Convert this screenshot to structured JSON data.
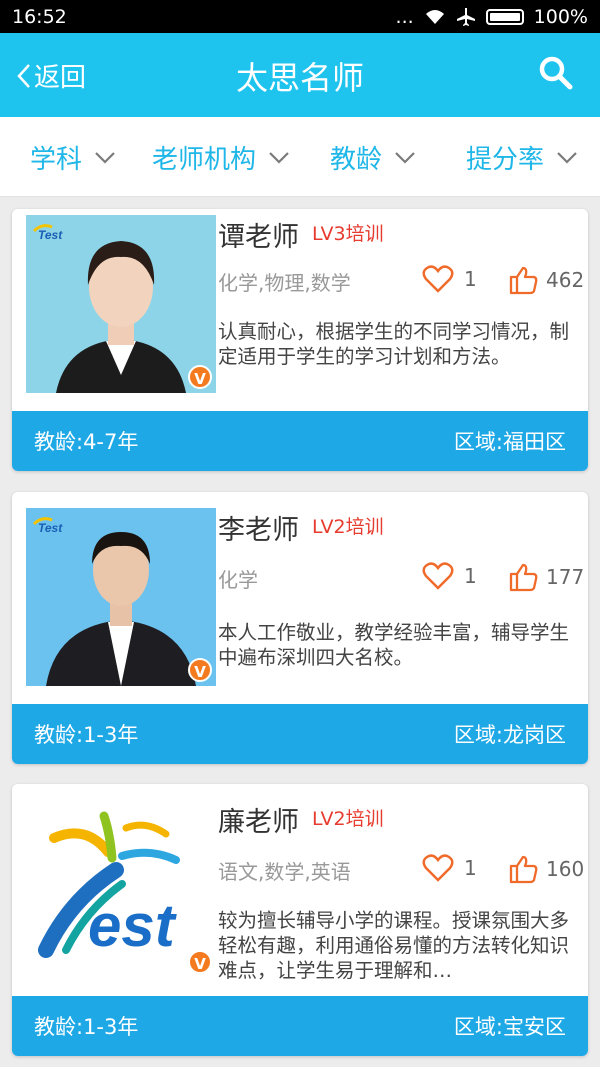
{
  "status": {
    "time": "16:52",
    "dots": "...",
    "battery": "100%"
  },
  "header": {
    "back_label": "返回",
    "title": "太思名师"
  },
  "filters": [
    {
      "label": "学科"
    },
    {
      "label": "老师机构"
    },
    {
      "label": "教龄"
    },
    {
      "label": "提分率"
    }
  ],
  "teachers": [
    {
      "name": "谭老师",
      "level": "LV3培训",
      "subjects": "化学,物理,数学",
      "likes": "1",
      "thumbs": "462",
      "description": "认真耐心，根据学生的不同学习情况，制定适用于学生的学习计划和方法。",
      "teaching_age": "教龄:4-7年",
      "area": "区域:福田区",
      "photo_logo": "Test",
      "badge": "V"
    },
    {
      "name": "李老师",
      "level": "LV2培训",
      "subjects": "化学",
      "likes": "1",
      "thumbs": "177",
      "description": "本人工作敬业，教学经验丰富，辅导学生中遍布深圳四大名校。",
      "teaching_age": "教龄:1-3年",
      "area": "区域:龙岗区",
      "photo_logo": "Test",
      "badge": "V"
    },
    {
      "name": "廉老师",
      "level": "LV2培训",
      "subjects": "语文,数学,英语",
      "likes": "1",
      "thumbs": "160",
      "description": "较为擅长辅导小学的课程。授课氛围大多轻松有趣，利用通俗易懂的方法转化知识难点，让学生易于理解和…",
      "teaching_age": "教龄:1-3年",
      "area": "区域:宝安区",
      "photo_logo": "Test",
      "badge": "V"
    }
  ],
  "colors": {
    "accent": "#1fc4ee",
    "footer": "#1ea8e6",
    "level": "#e63b2e",
    "heart": "#f06a2a"
  }
}
